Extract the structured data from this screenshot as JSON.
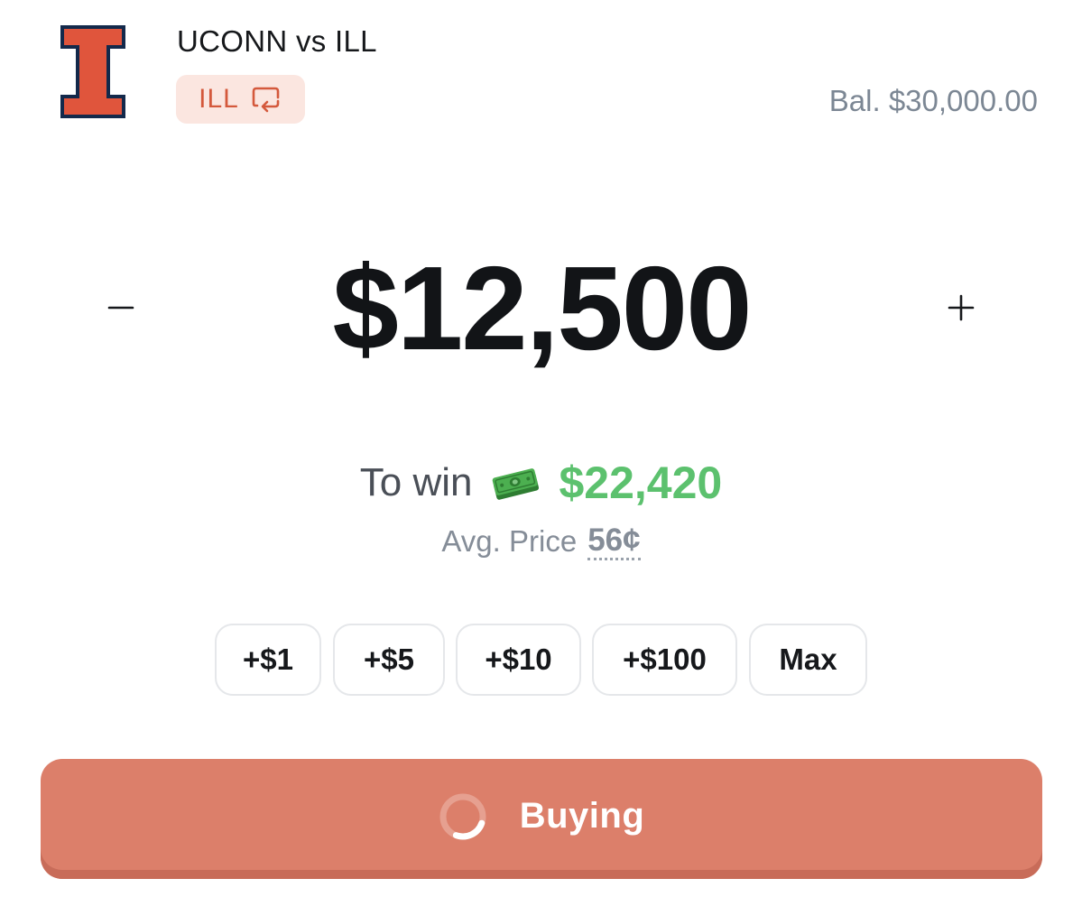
{
  "header": {
    "logo_icon": "illinois-block-i-logo",
    "match_title": "UCONN vs ILL",
    "side_badge": {
      "label": "ILL",
      "icon": "swap-icon"
    },
    "balance": "Bal. $30,000.00"
  },
  "amount": {
    "value": "$12,500",
    "decrement_symbol": "−",
    "increment_symbol": "+"
  },
  "payout": {
    "label": "To win",
    "icon": "cash-icon",
    "value": "$22,420",
    "avg_price_label": "Avg. Price",
    "avg_price_value": "56¢"
  },
  "quick_add": [
    {
      "label": "+$1"
    },
    {
      "label": "+$5"
    },
    {
      "label": "+$10"
    },
    {
      "label": "+$100"
    },
    {
      "label": "Max"
    }
  ],
  "buy_button": {
    "label": "Buying",
    "state_icon": "loading-spinner-icon"
  },
  "colors": {
    "accent": "#dc7f6a",
    "badge_bg": "#fbe6e0",
    "badge_text": "#d4593c",
    "win_green": "#5cc16e",
    "logo_orange": "#e0553c",
    "logo_navy": "#13294b"
  }
}
